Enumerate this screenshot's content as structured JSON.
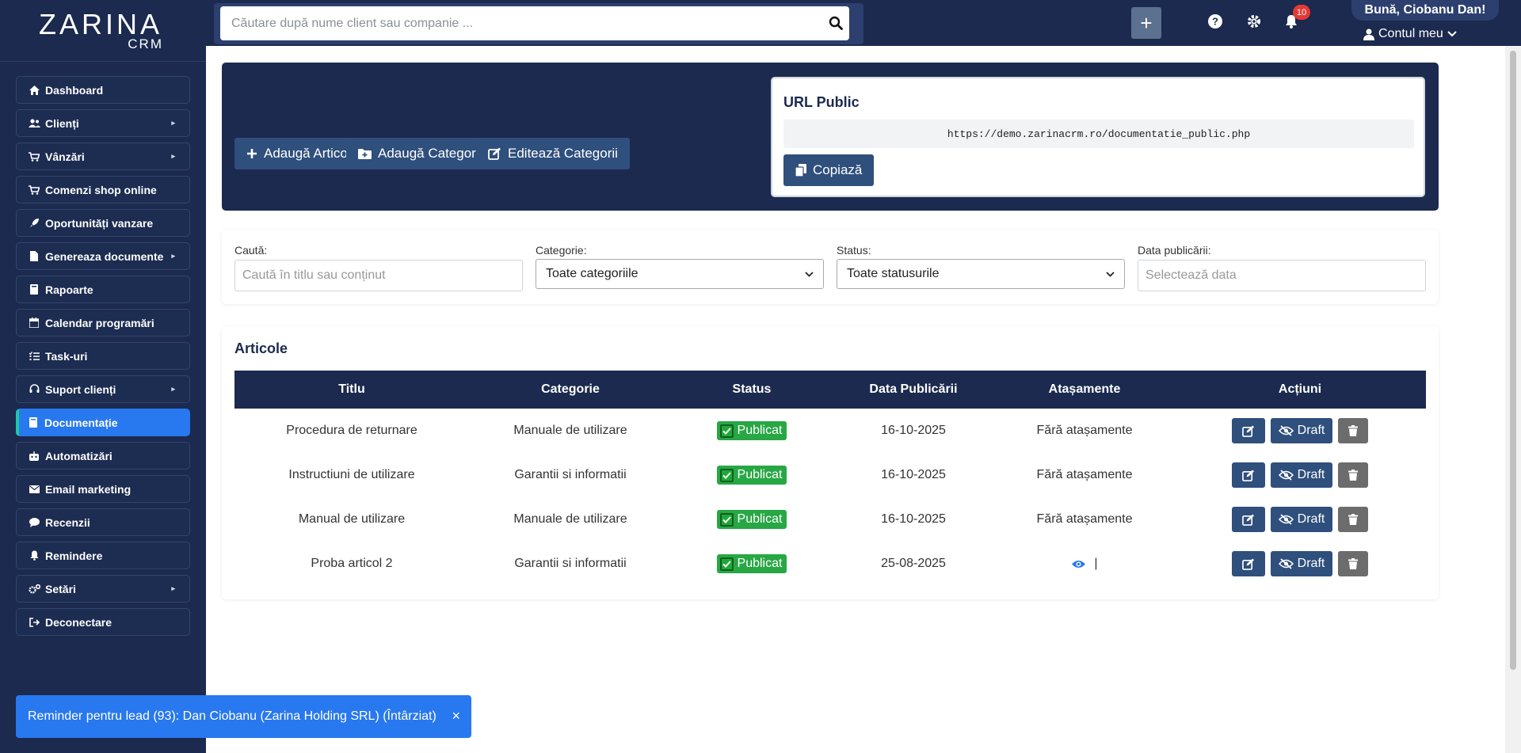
{
  "brand": {
    "name": "ZARINA",
    "sub": "CRM"
  },
  "search": {
    "placeholder": "Căutare după nume client sau companie ..."
  },
  "topbar": {
    "notifications_count": "10",
    "greeting": "Bună, Ciobanu Dan!",
    "account_label": "Contul meu"
  },
  "sidebar": {
    "items": [
      {
        "label": "Dashboard",
        "icon": "home-icon"
      },
      {
        "label": "Clienți",
        "icon": "users-icon",
        "submenu": true
      },
      {
        "label": "Vânzări",
        "icon": "cart-icon",
        "submenu": true
      },
      {
        "label": "Comenzi shop online",
        "icon": "cart-icon"
      },
      {
        "label": "Oportunități vanzare",
        "icon": "rocket-icon"
      },
      {
        "label": "Genereaza documente",
        "icon": "file-icon",
        "submenu": true
      },
      {
        "label": "Rapoarte",
        "icon": "book-icon"
      },
      {
        "label": "Calendar programări",
        "icon": "calendar-icon"
      },
      {
        "label": "Task-uri",
        "icon": "tasks-icon"
      },
      {
        "label": "Suport clienți",
        "icon": "headset-icon",
        "submenu": true
      },
      {
        "label": "Documentație",
        "icon": "book-icon",
        "active": true
      },
      {
        "label": "Automatizări",
        "icon": "robot-icon"
      },
      {
        "label": "Email marketing",
        "icon": "envelope-icon"
      },
      {
        "label": "Recenzii",
        "icon": "comment-icon"
      },
      {
        "label": "Remindere",
        "icon": "bell-icon"
      },
      {
        "label": "Setări",
        "icon": "cogs-icon",
        "submenu": true
      },
      {
        "label": "Deconectare",
        "icon": "logout-icon"
      }
    ]
  },
  "hero": {
    "add_article": "Adaugă Articol",
    "add_category": "Adaugă Categorie",
    "edit_categories": "Editează Categorii",
    "url_title": "URL Public",
    "url_value": "https://demo.zarinacrm.ro/documentatie_public.php",
    "copy_label": "Copiază"
  },
  "filters": {
    "search_label": "Caută:",
    "search_placeholder": "Caută în titlu sau conținut",
    "category_label": "Categorie:",
    "category_value": "Toate categoriile",
    "status_label": "Status:",
    "status_value": "Toate statusurile",
    "date_label": "Data publicării:",
    "date_placeholder": "Selectează data"
  },
  "articles": {
    "title": "Articole",
    "headers": [
      "Titlu",
      "Categorie",
      "Status",
      "Data Publicării",
      "Atașamente",
      "Acțiuni"
    ],
    "draft_label": "Draft",
    "rows": [
      {
        "title": "Procedura de returnare",
        "category": "Manuale de utilizare",
        "status": "Publicat",
        "date": "16-10-2025",
        "attachments": "Fără atașamente"
      },
      {
        "title": "Instructiuni de utilizare",
        "category": "Garantii si informatii",
        "status": "Publicat",
        "date": "16-10-2025",
        "attachments": "Fără atașamente"
      },
      {
        "title": "Manual de utilizare",
        "category": "Manuale de utilizare",
        "status": "Publicat",
        "date": "16-10-2025",
        "attachments": "Fără atașamente"
      },
      {
        "title": "Proba articol 2",
        "category": "Garantii si informatii",
        "status": "Publicat",
        "date": "25-08-2025",
        "attachments": "|"
      }
    ]
  },
  "toast": {
    "message": "Reminder pentru lead (93): Dan Ciobanu (Zarina Holding SRL) (Întârziat)",
    "close": "×"
  },
  "colors": {
    "navy": "#1b2a4e",
    "accent": "#2878f0",
    "button": "#2f4f7c",
    "success": "#28a745",
    "danger_badge": "#e53935"
  }
}
